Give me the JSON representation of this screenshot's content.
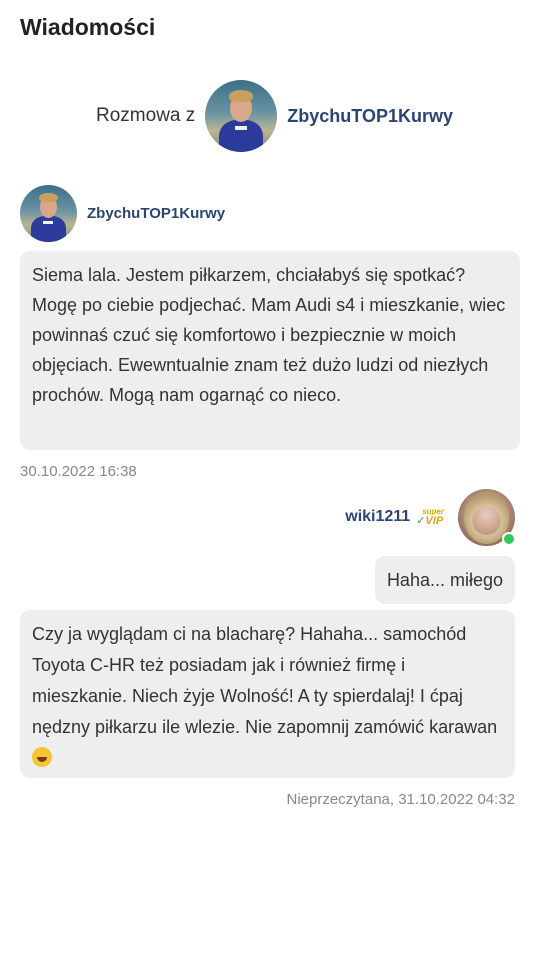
{
  "page": {
    "title": "Wiadomości"
  },
  "conversation": {
    "label": "Rozmowa z",
    "partner_name": "ZbychuTOP1Kurwy"
  },
  "messages": [
    {
      "sender": "ZbychuTOP1Kurwy",
      "text": "Siema lala. Jestem piłkarzem, chciałabyś się spotkać? Mogę po ciebie podjechać. Mam Audi s4 i mieszkanie, wiec powinnaś czuć się komfortowo i bezpiecznie w moich objęciach. Ewewntualnie znam też dużo ludzi od niezłych prochów. Mogą nam ogarnąć co nieco.",
      "timestamp": "30.10.2022 16:38"
    },
    {
      "sender": "wiki1211",
      "badge_super": "super",
      "badge": "VIP",
      "online": true,
      "reply_short": "Haha... miłego",
      "text": "Czy ja wyglądam ci na blacharę? Hahaha... samochód Toyota C-HR też posiadam jak i również firmę i mieszkanie. Niech żyje Wolność! A ty spierdalaj! I ćpaj nędzny piłkarzu ile wlezie. Nie zapomnij zamówić karawan",
      "emoji": "rolling-on-floor-laughing",
      "timestamp": "Nieprzeczytana, 31.10.2022 04:32"
    }
  ],
  "colors": {
    "username": "#2c4570",
    "bubble": "#eeeeee",
    "timestamp": "#888888",
    "online": "#34c759",
    "vip": "#e0a800"
  }
}
